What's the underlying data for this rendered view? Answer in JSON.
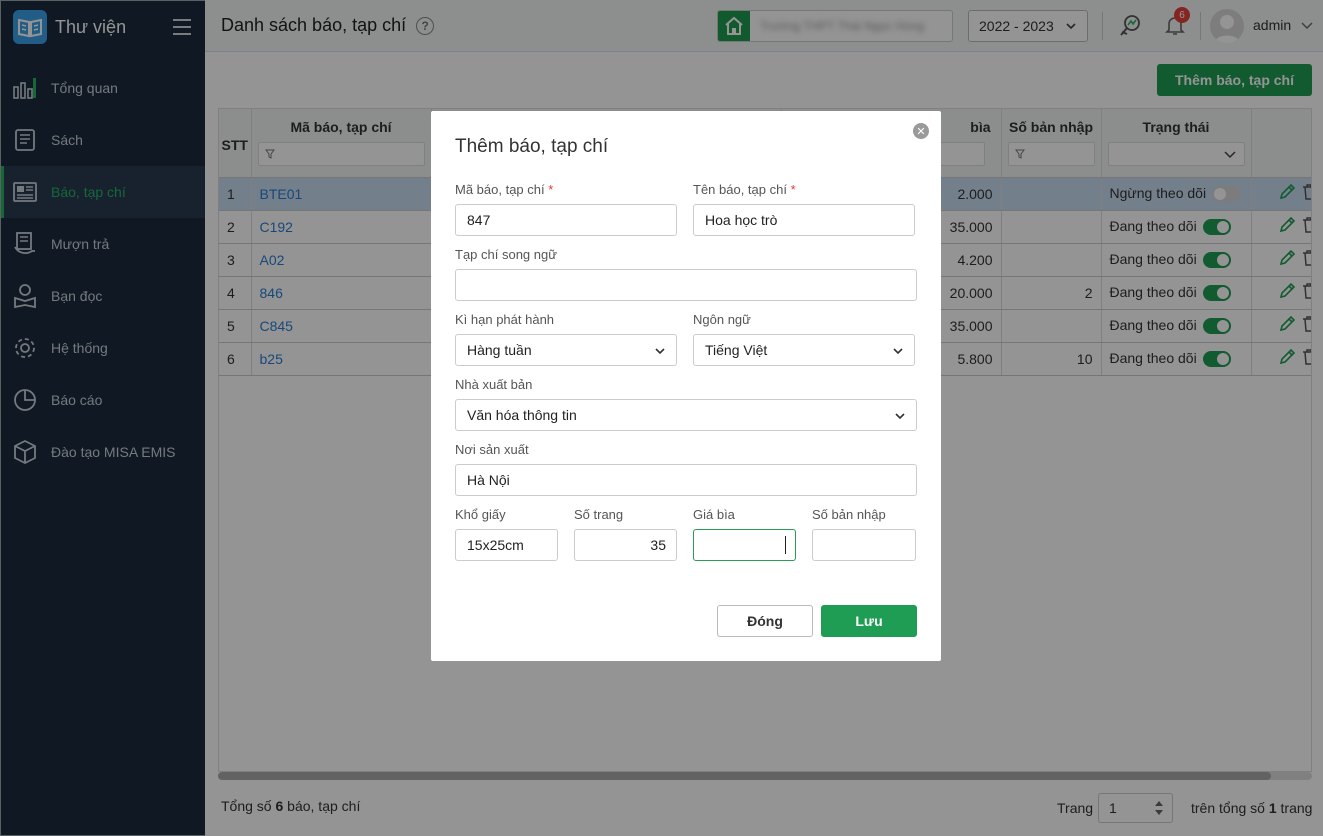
{
  "app": {
    "title": "Thư viện"
  },
  "sidebar": {
    "items": [
      {
        "label": "Tổng quan",
        "icon": "chart-bars-icon"
      },
      {
        "label": "Sách",
        "icon": "book-icon"
      },
      {
        "label": "Báo, tạp chí",
        "icon": "newspaper-icon",
        "active": true
      },
      {
        "label": "Mượn trả",
        "icon": "borrow-return-icon"
      },
      {
        "label": "Bạn đọc",
        "icon": "reader-icon"
      },
      {
        "label": "Hệ thống",
        "icon": "gear-icon"
      },
      {
        "label": "Báo cáo",
        "icon": "pie-chart-icon"
      },
      {
        "label": "Đào tạo MISA EMIS",
        "icon": "cube-icon"
      }
    ]
  },
  "header": {
    "page_title": "Danh sách báo, tạp chí",
    "school_name": "Trường THPT Thái Ngọc Hùng",
    "school_year": "2022 - 2023",
    "notification_count": "6",
    "username": "admin"
  },
  "toolbar": {
    "add_label": "Thêm báo, tạp chí"
  },
  "table": {
    "columns": {
      "stt": "STT",
      "code": "Mã báo, tạp chí",
      "price": "bìa",
      "drafts": "Số bản nhập",
      "status": "Trạng thái"
    },
    "rows": [
      {
        "stt": "1",
        "code": "BTE01",
        "price": "2.000",
        "drafts": "",
        "status": "Ngừng theo dõi",
        "on": false
      },
      {
        "stt": "2",
        "code": "C192",
        "price": "35.000",
        "drafts": "",
        "status": "Đang theo dõi",
        "on": true
      },
      {
        "stt": "3",
        "code": "A02",
        "price": "4.200",
        "drafts": "",
        "status": "Đang theo dõi",
        "on": true
      },
      {
        "stt": "4",
        "code": "846",
        "price": "20.000",
        "drafts": "2",
        "status": "Đang theo dõi",
        "on": true
      },
      {
        "stt": "5",
        "code": "C845",
        "price": "35.000",
        "drafts": "",
        "status": "Đang theo dõi",
        "on": true
      },
      {
        "stt": "6",
        "code": "b25",
        "price": "5.800",
        "drafts": "10",
        "status": "Đang theo dõi",
        "on": true
      }
    ]
  },
  "footer": {
    "total_prefix": "Tổng số",
    "total_count": "6",
    "total_suffix": "báo, tạp chí",
    "page_label": "Trang",
    "page_value": "1",
    "page_total_prefix": "trên tổng số",
    "page_total": "1",
    "page_total_suffix": "trang"
  },
  "dialog": {
    "title": "Thêm báo, tạp chí",
    "fields": {
      "code_label": "Mã báo, tạp chí",
      "code_value": "847",
      "name_label": "Tên báo, tạp chí",
      "name_value": "Hoa học trò",
      "bilingual_label": "Tạp chí song ngữ",
      "bilingual_value": "",
      "period_label": "Kì hạn phát hành",
      "period_value": "Hàng tuần",
      "language_label": "Ngôn ngữ",
      "language_value": "Tiếng Việt",
      "publisher_label": "Nhà xuất bản",
      "publisher_value": "Văn hóa thông tin",
      "place_label": "Nơi sản xuất",
      "place_value": "Hà Nội",
      "paper_label": "Khổ giấy",
      "paper_value": "15x25cm",
      "pages_label": "Số trang",
      "pages_value": "35",
      "price_label": "Giá bìa",
      "price_value": "",
      "drafts_label": "Số bản nhập",
      "drafts_value": ""
    },
    "required_mark": "*",
    "close_label": "Đóng",
    "save_label": "Lưu"
  },
  "colors": {
    "sidebar": "#1c2a3d",
    "accent": "#1f9d55",
    "link": "#2a7dd0",
    "selected_row": "#c7dcef"
  }
}
